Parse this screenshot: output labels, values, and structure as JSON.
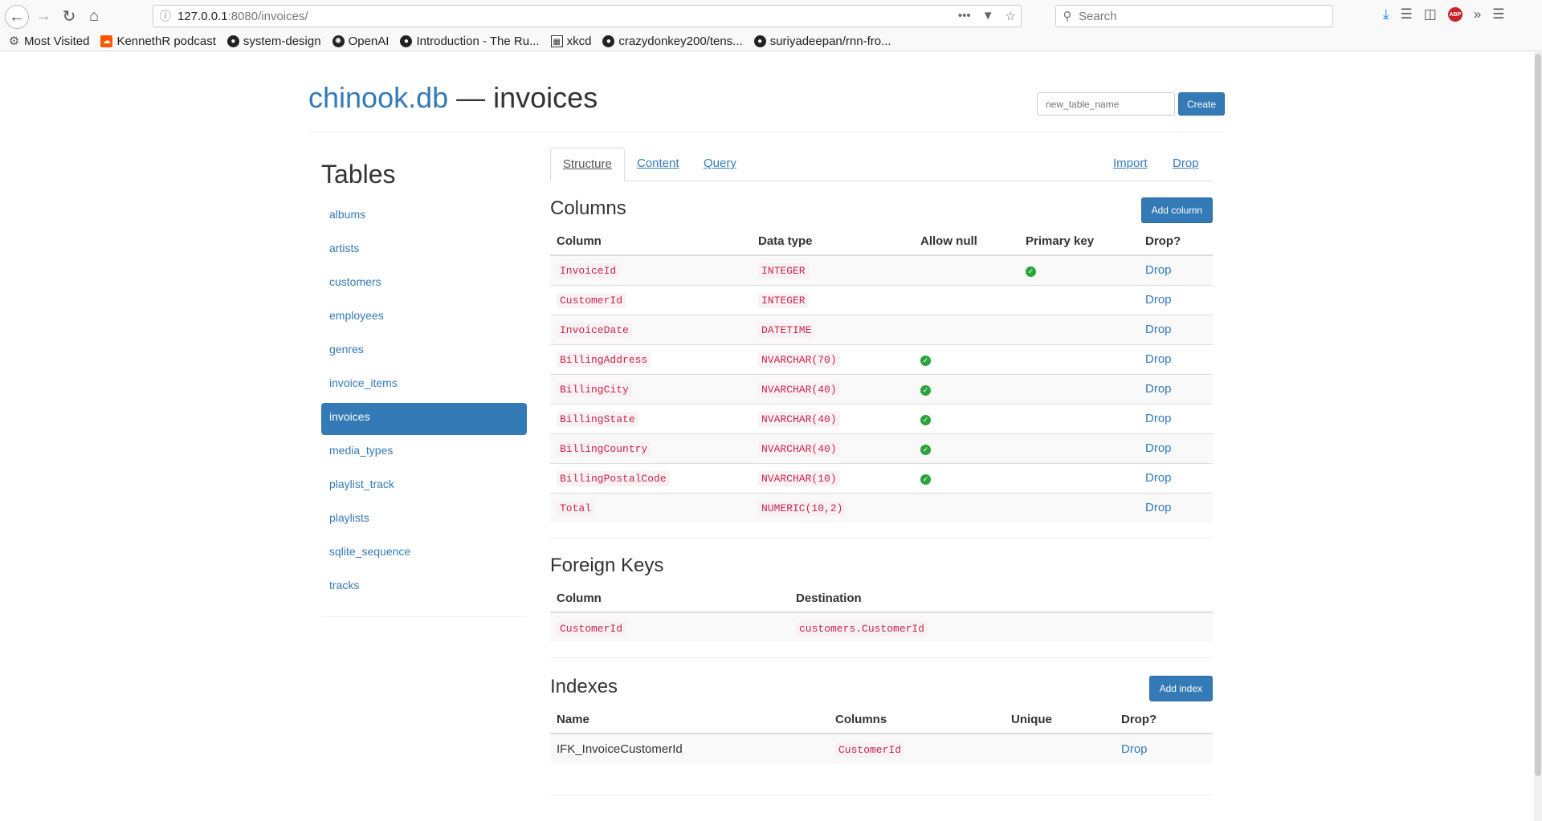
{
  "browser": {
    "url_host": "127.0.0.1",
    "url_path": ":8080/invoices/",
    "search_placeholder": "Search",
    "bookmarks": [
      {
        "label": "Most Visited",
        "icon": "gear-icon"
      },
      {
        "label": "KennethR podcast",
        "icon": "soundcloud-icon"
      },
      {
        "label": "system-design",
        "icon": "github-icon"
      },
      {
        "label": "OpenAI",
        "icon": "openai-icon"
      },
      {
        "label": "Introduction - The Ru...",
        "icon": "github-icon"
      },
      {
        "label": "xkcd",
        "icon": "xkcd-icon"
      },
      {
        "label": "crazydonkey200/tens...",
        "icon": "github-icon"
      },
      {
        "label": "suriyadeepan/rnn-fro...",
        "icon": "github-icon"
      }
    ]
  },
  "header": {
    "db_name": "chinook.db",
    "title_suffix": " — invoices",
    "new_table_placeholder": "new_table_name",
    "create_label": "Create"
  },
  "sidebar": {
    "heading": "Tables",
    "items": [
      "albums",
      "artists",
      "customers",
      "employees",
      "genres",
      "invoice_items",
      "invoices",
      "media_types",
      "playlist_track",
      "playlists",
      "sqlite_sequence",
      "tracks"
    ],
    "active": "invoices"
  },
  "tabs": {
    "structure": "Structure",
    "content": "Content",
    "query": "Query",
    "import": "Import",
    "drop": "Drop"
  },
  "columns": {
    "heading": "Columns",
    "add_label": "Add column",
    "headers": [
      "Column",
      "Data type",
      "Allow null",
      "Primary key",
      "Drop?"
    ],
    "rows": [
      {
        "name": "InvoiceId",
        "type": "INTEGER",
        "allow_null": false,
        "primary_key": true
      },
      {
        "name": "CustomerId",
        "type": "INTEGER",
        "allow_null": false,
        "primary_key": false
      },
      {
        "name": "InvoiceDate",
        "type": "DATETIME",
        "allow_null": false,
        "primary_key": false
      },
      {
        "name": "BillingAddress",
        "type": "NVARCHAR(70)",
        "allow_null": true,
        "primary_key": false
      },
      {
        "name": "BillingCity",
        "type": "NVARCHAR(40)",
        "allow_null": true,
        "primary_key": false
      },
      {
        "name": "BillingState",
        "type": "NVARCHAR(40)",
        "allow_null": true,
        "primary_key": false
      },
      {
        "name": "BillingCountry",
        "type": "NVARCHAR(40)",
        "allow_null": true,
        "primary_key": false
      },
      {
        "name": "BillingPostalCode",
        "type": "NVARCHAR(10)",
        "allow_null": true,
        "primary_key": false
      },
      {
        "name": "Total",
        "type": "NUMERIC(10,2)",
        "allow_null": false,
        "primary_key": false
      }
    ],
    "drop_label": "Drop"
  },
  "foreign_keys": {
    "heading": "Foreign Keys",
    "headers": [
      "Column",
      "Destination"
    ],
    "rows": [
      {
        "column": "CustomerId",
        "destination": "customers.CustomerId"
      }
    ]
  },
  "indexes": {
    "heading": "Indexes",
    "add_label": "Add index",
    "headers": [
      "Name",
      "Columns",
      "Unique",
      "Drop?"
    ],
    "rows": [
      {
        "name": "IFK_InvoiceCustomerId",
        "columns": "CustomerId",
        "unique": "",
        "drop": "Drop"
      }
    ]
  },
  "colors": {
    "link": "#337ab7",
    "code": "#c7254e",
    "check": "#2aa43c"
  }
}
